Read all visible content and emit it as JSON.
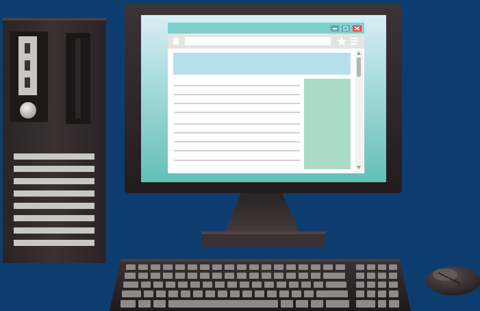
{
  "scene": {
    "background": "#0d3d6e",
    "objects": [
      "tower-case",
      "monitor",
      "keyboard",
      "mouse"
    ]
  },
  "browser": {
    "controls": [
      "minimize-icon",
      "restore-icon",
      "close-icon"
    ],
    "toolbar_icons": [
      "home-icon",
      "star-icon",
      "menu-icon"
    ],
    "scrollbar": [
      "scroll-up-icon",
      "scroll-down-icon"
    ]
  },
  "colors": {
    "screen_gradient_top": "#d7eef5",
    "screen_gradient_bottom": "#63bfb8",
    "browser_titlebar": "#7fd0cc",
    "browser_close": "#e24a4a",
    "banner": "#b5e0ed",
    "sidebar": "#aadcc7",
    "tower_body": "#342b2d",
    "vent": "#c9c7c4"
  }
}
